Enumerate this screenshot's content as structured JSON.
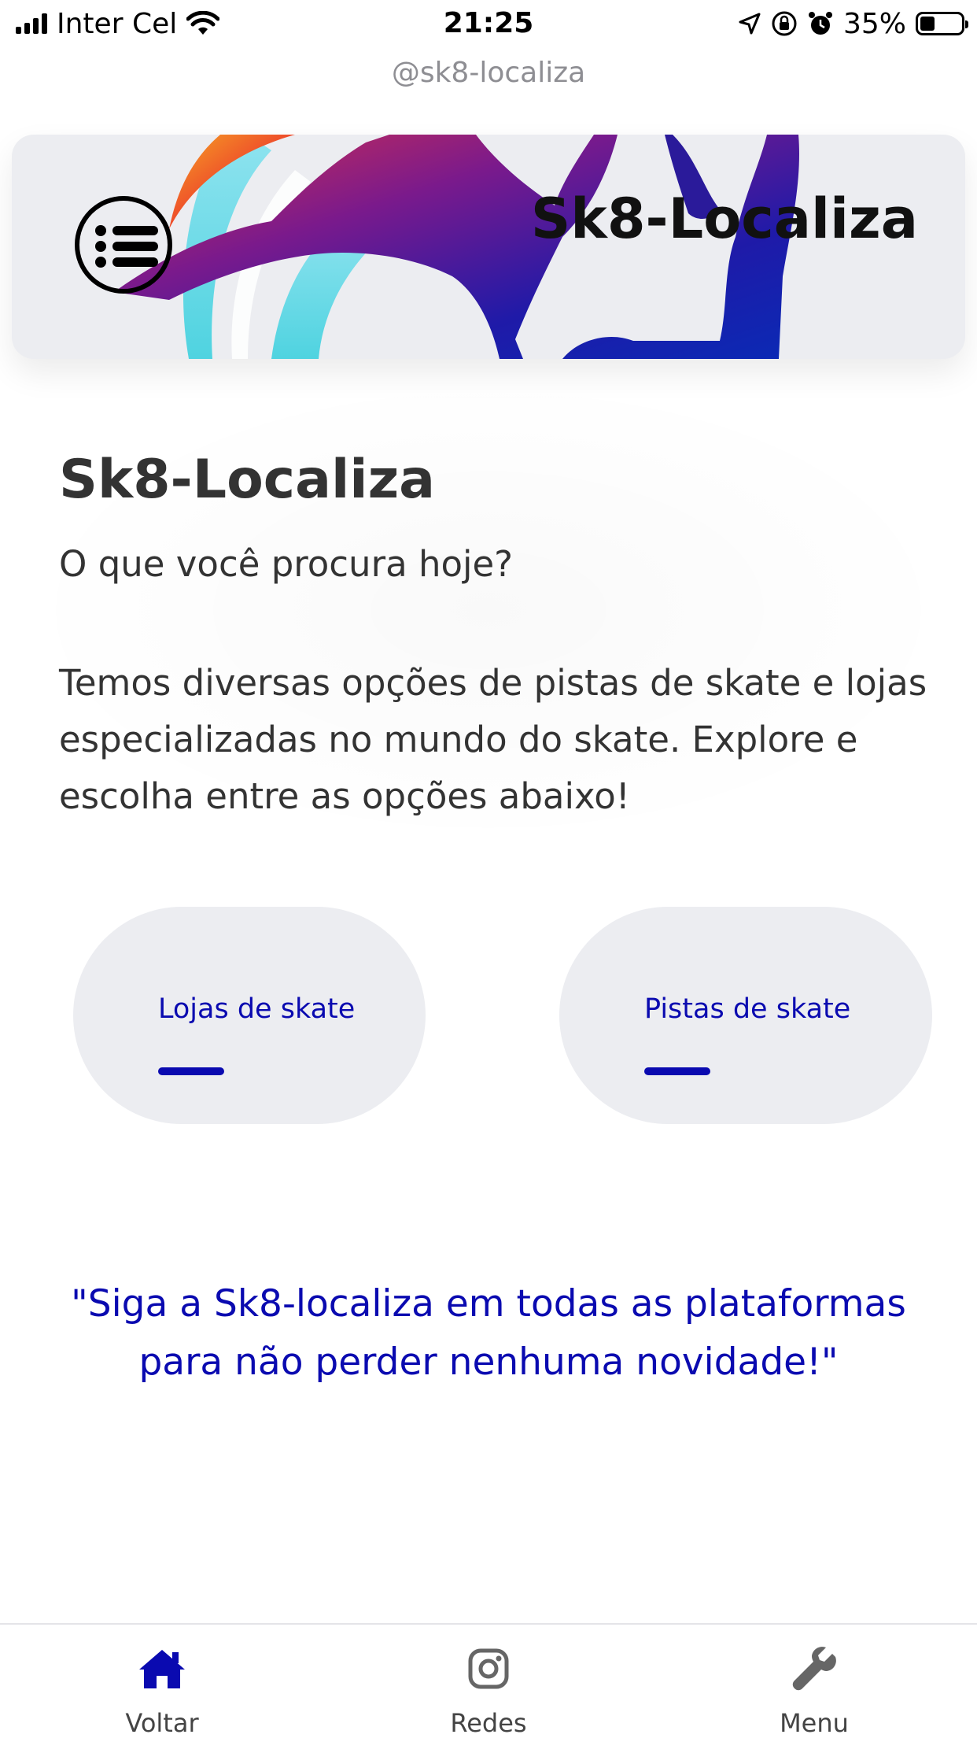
{
  "status_bar": {
    "carrier": "Inter Cel",
    "time": "21:25",
    "battery_percent": "35%",
    "battery_level": 0.35
  },
  "browser": {
    "url": "@sk8-localiza"
  },
  "header": {
    "title": "Sk8-Localiza",
    "menu_icon": "list-icon"
  },
  "intro": {
    "title": "Sk8-Localiza",
    "subtitle": "O que você procura hoje?",
    "description": "Temos diversas opções de pistas de skate e lojas especializadas no mundo do skate. Explore e escolha entre as opções abaixo!"
  },
  "actions": [
    {
      "label": "Lojas de skate"
    },
    {
      "label": "Pistas de skate"
    }
  ],
  "quote": "\"Siga a Sk8-localiza em todas as plataformas para não perder nenhuma novidade!\"",
  "bottom_nav": [
    {
      "label": "Voltar",
      "icon": "home-icon",
      "active": true
    },
    {
      "label": "Redes",
      "icon": "instagram-icon",
      "active": false
    },
    {
      "label": "Menu",
      "icon": "wrench-icon",
      "active": false
    }
  ],
  "colors": {
    "accent": "#0a0ab0",
    "card_bg": "#ecedf1",
    "text": "#333333"
  }
}
